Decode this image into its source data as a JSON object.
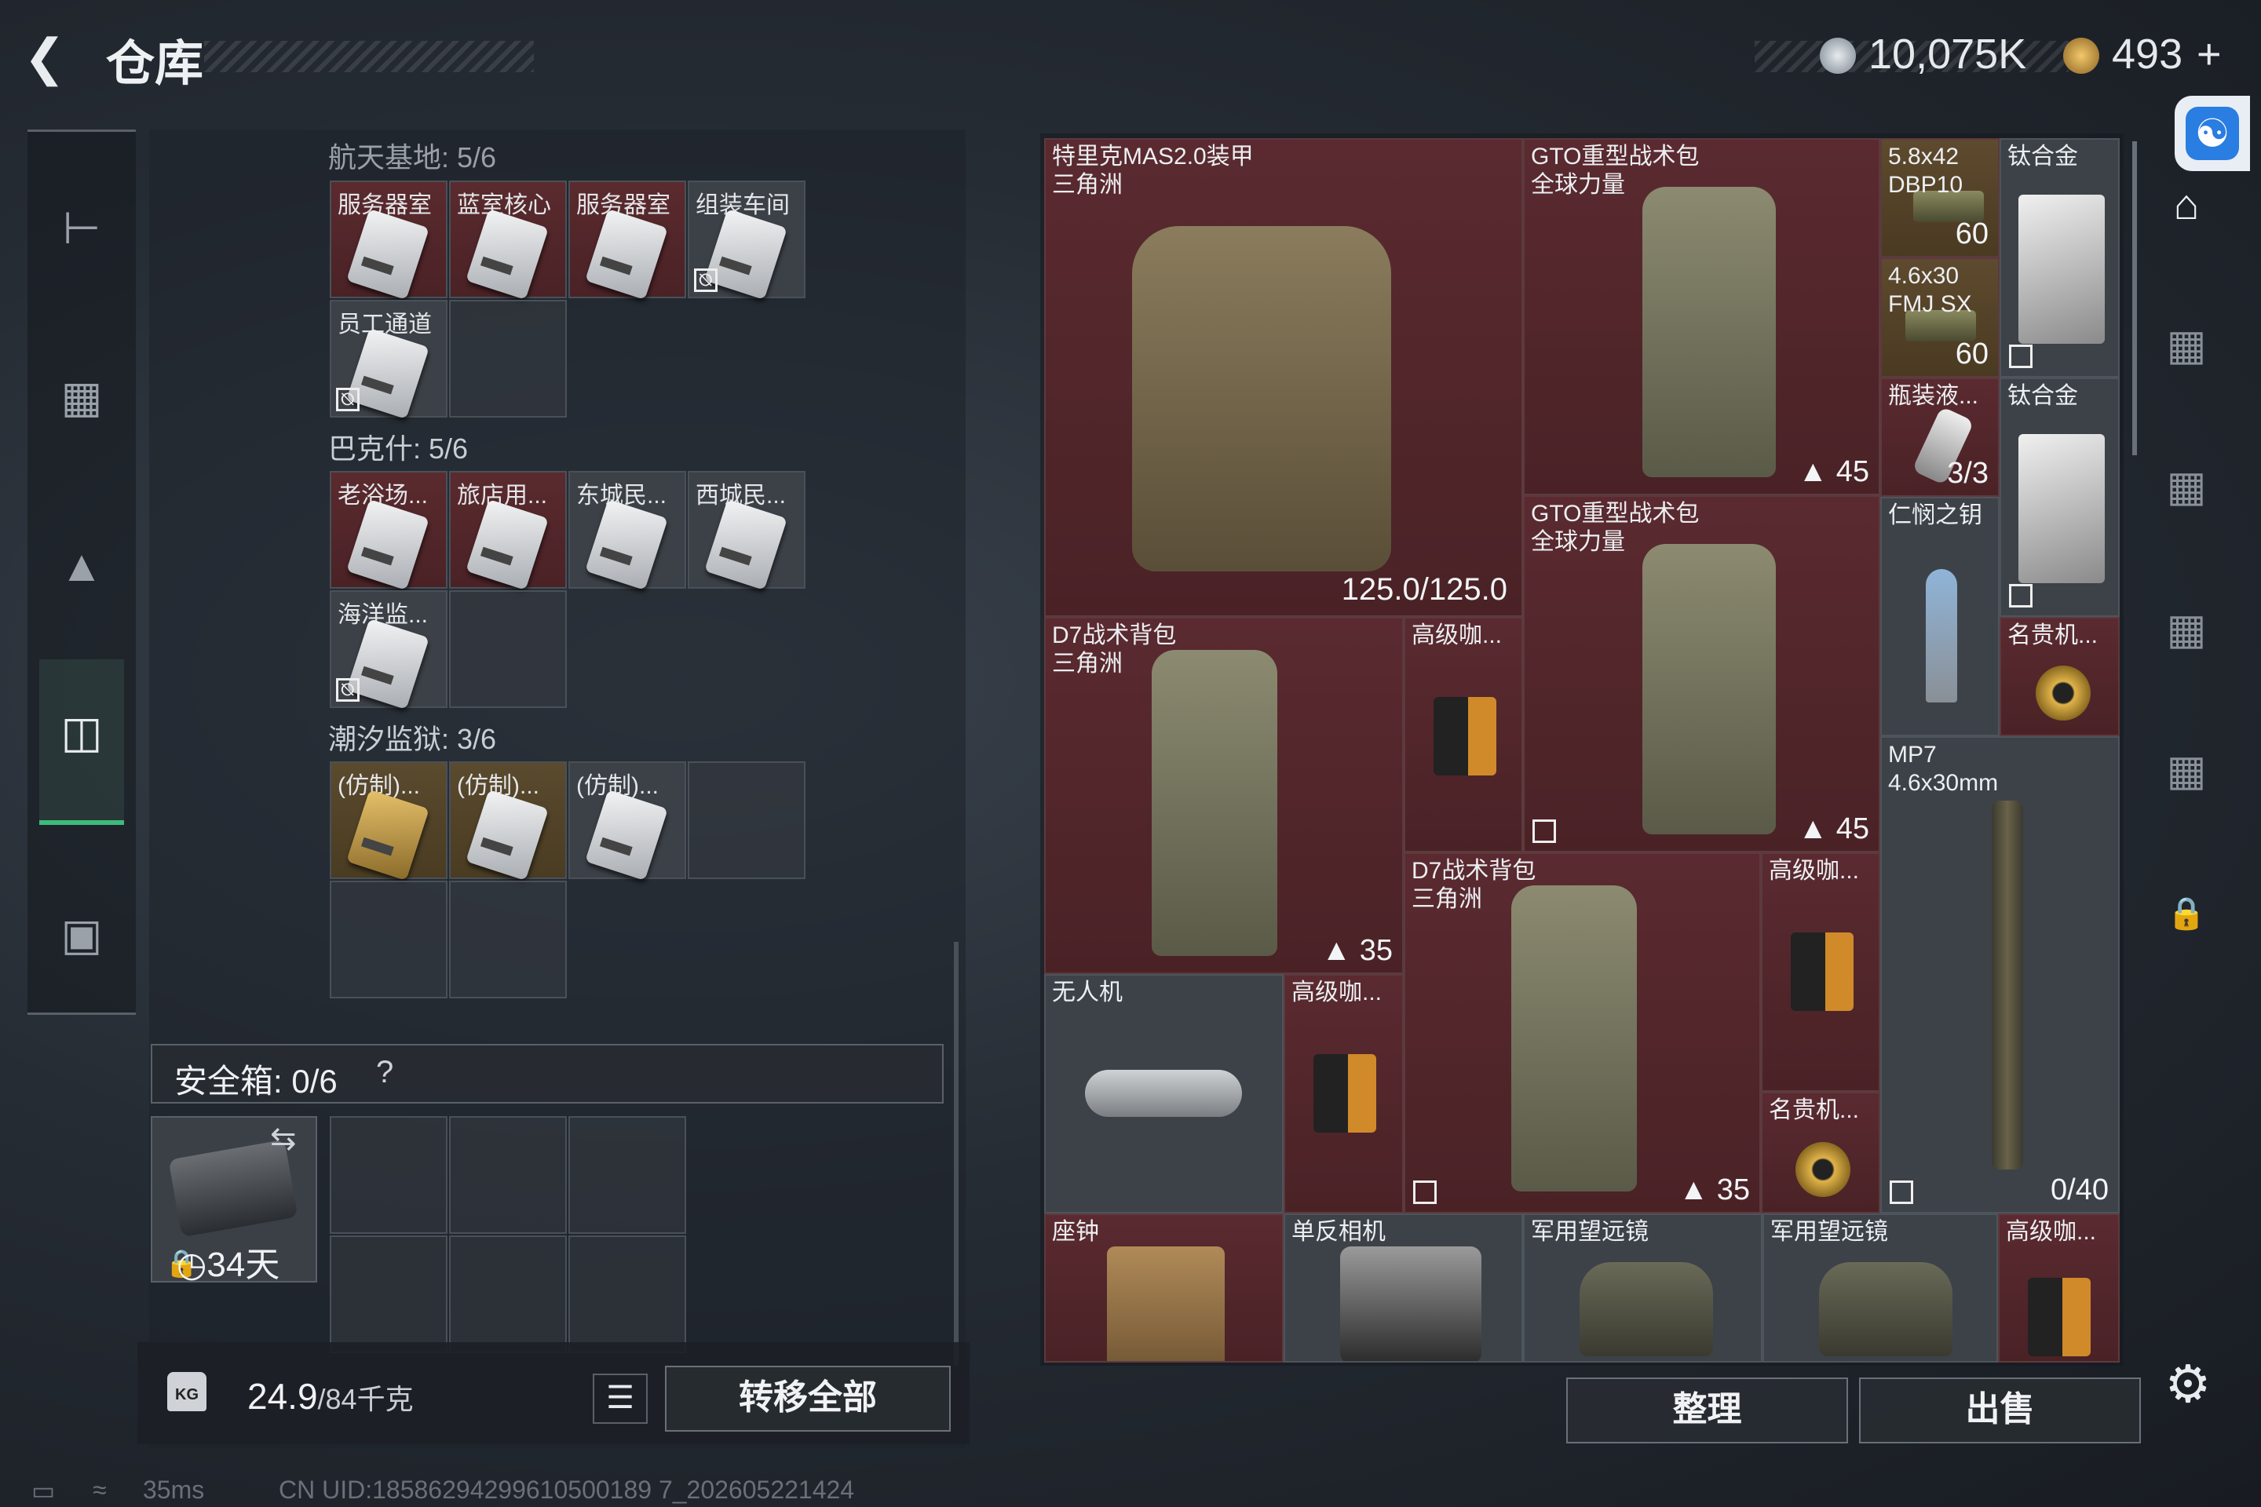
{
  "header": {
    "back_icon": "back-arrow-icon",
    "title": "仓库",
    "currency_1": {
      "icon": "silver-coin-icon",
      "value": "10,075K",
      "color": "#b9c0c8"
    },
    "currency_2": {
      "icon": "gold-coin-icon",
      "value": "493",
      "plus": "+",
      "color": "#d9a63a"
    }
  },
  "accessibility_icon": "accessibility-icon",
  "left_rail": [
    "pistol-icon",
    "gear-bag-icon",
    "backpack-icon",
    "locker-icon",
    "briefcase-icon"
  ],
  "keycards": {
    "sections": [
      {
        "title": "航天基地: 5/6",
        "cards": [
          "服务器室",
          "蓝室核心",
          "服务器室",
          "组装车间",
          "员工通道"
        ]
      },
      {
        "title": "巴克什: 5/6",
        "cards": [
          "老浴场...",
          "旅店用...",
          "东城民...",
          "西城民...",
          "海洋监..."
        ]
      },
      {
        "title": "潮汐监狱: 3/6",
        "cards": [
          "(仿制)...",
          "(仿制)...",
          "(仿制)..."
        ]
      }
    ]
  },
  "safebox": {
    "label": "安全箱: 0/6",
    "help": "?",
    "timer": "34天"
  },
  "weight": {
    "value": "24.9",
    "max": "/84千克",
    "kg_icon": "KG"
  },
  "buttons": {
    "transfer_all": "转移全部",
    "sort": "整理",
    "sell": "出售"
  },
  "items": {
    "armor": {
      "label": "特里克MAS2.0装甲\n三角洲",
      "durability": "125.0/125.0"
    },
    "gto1": {
      "label": "GTO重型战术包\n全球力量",
      "count": "45"
    },
    "gto2": {
      "label": "GTO重型战术包\n全球力量",
      "count": "45"
    },
    "ammo1": {
      "label": "5.8x42\nDBP10",
      "count": "60"
    },
    "ammo2": {
      "label": "4.6x30\nFMJ SX",
      "count": "60"
    },
    "titanium1": {
      "label": "钛合金"
    },
    "titanium2": {
      "label": "钛合金"
    },
    "bottle": {
      "label": "瓶装液...",
      "count": "3/3"
    },
    "key": {
      "label": "仁悯之钥"
    },
    "watch1": {
      "label": "名贵机..."
    },
    "d7a": {
      "label": "D7战术背包\n三角洲",
      "count": "35"
    },
    "coffee1": {
      "label": "高级咖..."
    },
    "d7b": {
      "label": "D7战术背包\n三角洲",
      "count": "35"
    },
    "coffee2": {
      "label": "高级咖..."
    },
    "mp7": {
      "label": "MP7\n4.6x30mm",
      "count": "0/40"
    },
    "drone": {
      "label": "无人机"
    },
    "coffee3": {
      "label": "高级咖..."
    },
    "watch2": {
      "label": "名贵机..."
    },
    "clock": {
      "label": "座钟"
    },
    "camera": {
      "label": "单反相机"
    },
    "binoc1": {
      "label": "军用望远镜"
    },
    "binoc2": {
      "label": "军用望远镜"
    },
    "coffee4": {
      "label": "高级咖..."
    }
  },
  "right_rail": [
    "home-icon",
    "tier-4-icon",
    "tier-3-icon",
    "tier-2-icon",
    "tier-1-icon",
    "lock-icon",
    "settings-icon"
  ],
  "status": {
    "ping": "35ms",
    "uid": "CN UID:18586294299610500189 7_202605221424"
  }
}
